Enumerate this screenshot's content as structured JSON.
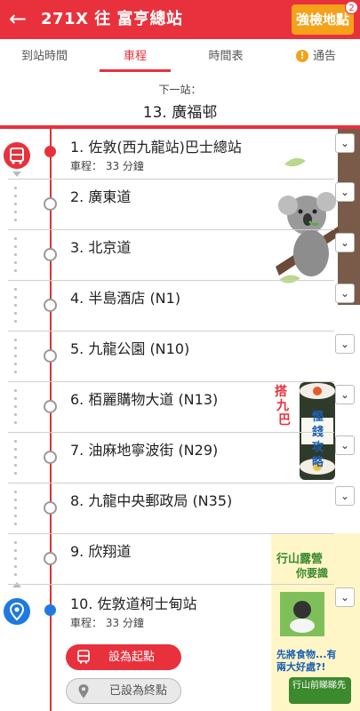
{
  "header": {
    "back_icon": "arrow-left-icon",
    "title": "271X 往 富亨總站",
    "strong_button": "強檢地點",
    "badge_count": "2",
    "colors": {
      "primary": "#e8313c",
      "accent": "#f5a21a"
    }
  },
  "tabs": [
    {
      "label": "到站時間"
    },
    {
      "label": "車程"
    },
    {
      "label": "時間表"
    },
    {
      "label": "通告"
    }
  ],
  "active_tab": "車程",
  "next_stop": {
    "label": "下一站：",
    "value": "13. 廣福邨"
  },
  "stops": [
    {
      "name": "1. 佐敦(西九龍站)巴士總站",
      "sub": "車程： 33 分鐘"
    },
    {
      "name": "2. 廣東道"
    },
    {
      "name": "3. 北京道"
    },
    {
      "name": "4. 半島酒店 (N1)"
    },
    {
      "name": "5. 九龍公園 (N10)"
    },
    {
      "name": "6. 栢麗購物大道 (N13)"
    },
    {
      "name": "7. 油麻地寧波街 (N29)"
    },
    {
      "name": "8. 九龍中央郵政局 (N35)"
    },
    {
      "name": "9. 欣翔道"
    },
    {
      "name": "10. 佐敦道柯士甸站",
      "sub": "車程： 33 分鐘"
    }
  ],
  "actions": {
    "set_start": "設為起點",
    "set_end": "已設為終點"
  },
  "ads": {
    "ad2_text": [
      "搭",
      "九",
      "巴",
      "慳",
      "錢",
      "攻",
      "略"
    ],
    "ad3_title": "行山露營",
    "ad3_sub": "你要識",
    "ad3_mid": "先將食物...有兩大好處?!",
    "ad3_bottom": "行山前睇睇先"
  }
}
